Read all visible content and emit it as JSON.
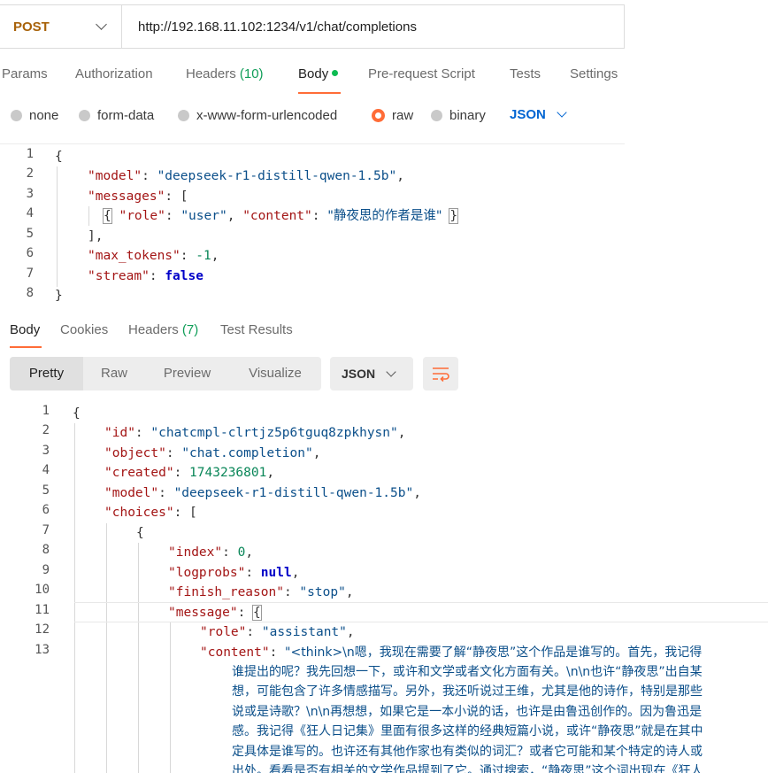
{
  "request": {
    "method": "POST",
    "url": "http://192.168.11.102:1234/v1/chat/completions"
  },
  "request_tabs": {
    "params": "Params",
    "authorization": "Authorization",
    "headers": "Headers",
    "headers_count": "(10)",
    "body": "Body",
    "pre_request": "Pre-request Script",
    "tests": "Tests",
    "settings": "Settings"
  },
  "body_types": {
    "none": "none",
    "form_data": "form-data",
    "urlencoded": "x-www-form-urlencoded",
    "raw": "raw",
    "binary": "binary",
    "selected_format": "JSON"
  },
  "request_body": {
    "line_numbers": [
      "1",
      "2",
      "3",
      "4",
      "5",
      "6",
      "7",
      "8"
    ],
    "model_key": "\"model\"",
    "model_value": "\"deepseek-r1-distill-qwen-1.5b\"",
    "messages_key": "\"messages\"",
    "role_key": "\"role\"",
    "role_value": "\"user\"",
    "content_key": "\"content\"",
    "content_value": "\"静夜思的作者是谁\"",
    "max_tokens_key": "\"max_tokens\"",
    "max_tokens_value": "-1",
    "stream_key": "\"stream\"",
    "stream_value": "false"
  },
  "response_tabs": {
    "body": "Body",
    "cookies": "Cookies",
    "headers": "Headers",
    "headers_count": "(7)",
    "test_results": "Test Results"
  },
  "view_modes": {
    "pretty": "Pretty",
    "raw": "Raw",
    "preview": "Preview",
    "visualize": "Visualize",
    "format": "JSON"
  },
  "response_body": {
    "line_numbers": [
      "1",
      "2",
      "3",
      "4",
      "5",
      "6",
      "7",
      "8",
      "9",
      "10",
      "11",
      "12",
      "13"
    ],
    "id_key": "\"id\"",
    "id_value": "\"chatcmpl-clrtjz5p6tguq8zpkhysn\"",
    "object_key": "\"object\"",
    "object_value": "\"chat.completion\"",
    "created_key": "\"created\"",
    "created_value": "1743236801",
    "model_key": "\"model\"",
    "model_value": "\"deepseek-r1-distill-qwen-1.5b\"",
    "choices_key": "\"choices\"",
    "index_key": "\"index\"",
    "index_value": "0",
    "logprobs_key": "\"logprobs\"",
    "logprobs_value": "null",
    "finish_reason_key": "\"finish_reason\"",
    "finish_reason_value": "\"stop\"",
    "message_key": "\"message\"",
    "role_key": "\"role\"",
    "role_value": "\"assistant\"",
    "content_key": "\"content\"",
    "content_line1": "\"<think>\\n嗯，我现在需要了解“静夜思”这个作品是谁写的。首先，我记得",
    "content_cont": [
      "谁提出的呢？我先回想一下，或许和文学或者文化方面有关。\\n\\n也许“静夜思”出自某",
      "想，可能包含了许多情感描写。另外，我还听说过王维，尤其是他的诗作，特别是那些",
      "说或是诗歌？\\n\\n再想想，如果它是一本小说的话，也许是由鲁迅创作的。因为鲁迅是",
      "感。我记得《狂人日记集》里面有很多这样的经典短篇小说，或许“静夜思”就是在其中",
      "定具体是谁写的。也许还有其他作家也有类似的词汇？或者它可能和某个特定的诗人或",
      "出处。看看是否有相关的文学作品提到了它。通过搜索，“静夜思”这个词出现在《狂人"
    ]
  }
}
